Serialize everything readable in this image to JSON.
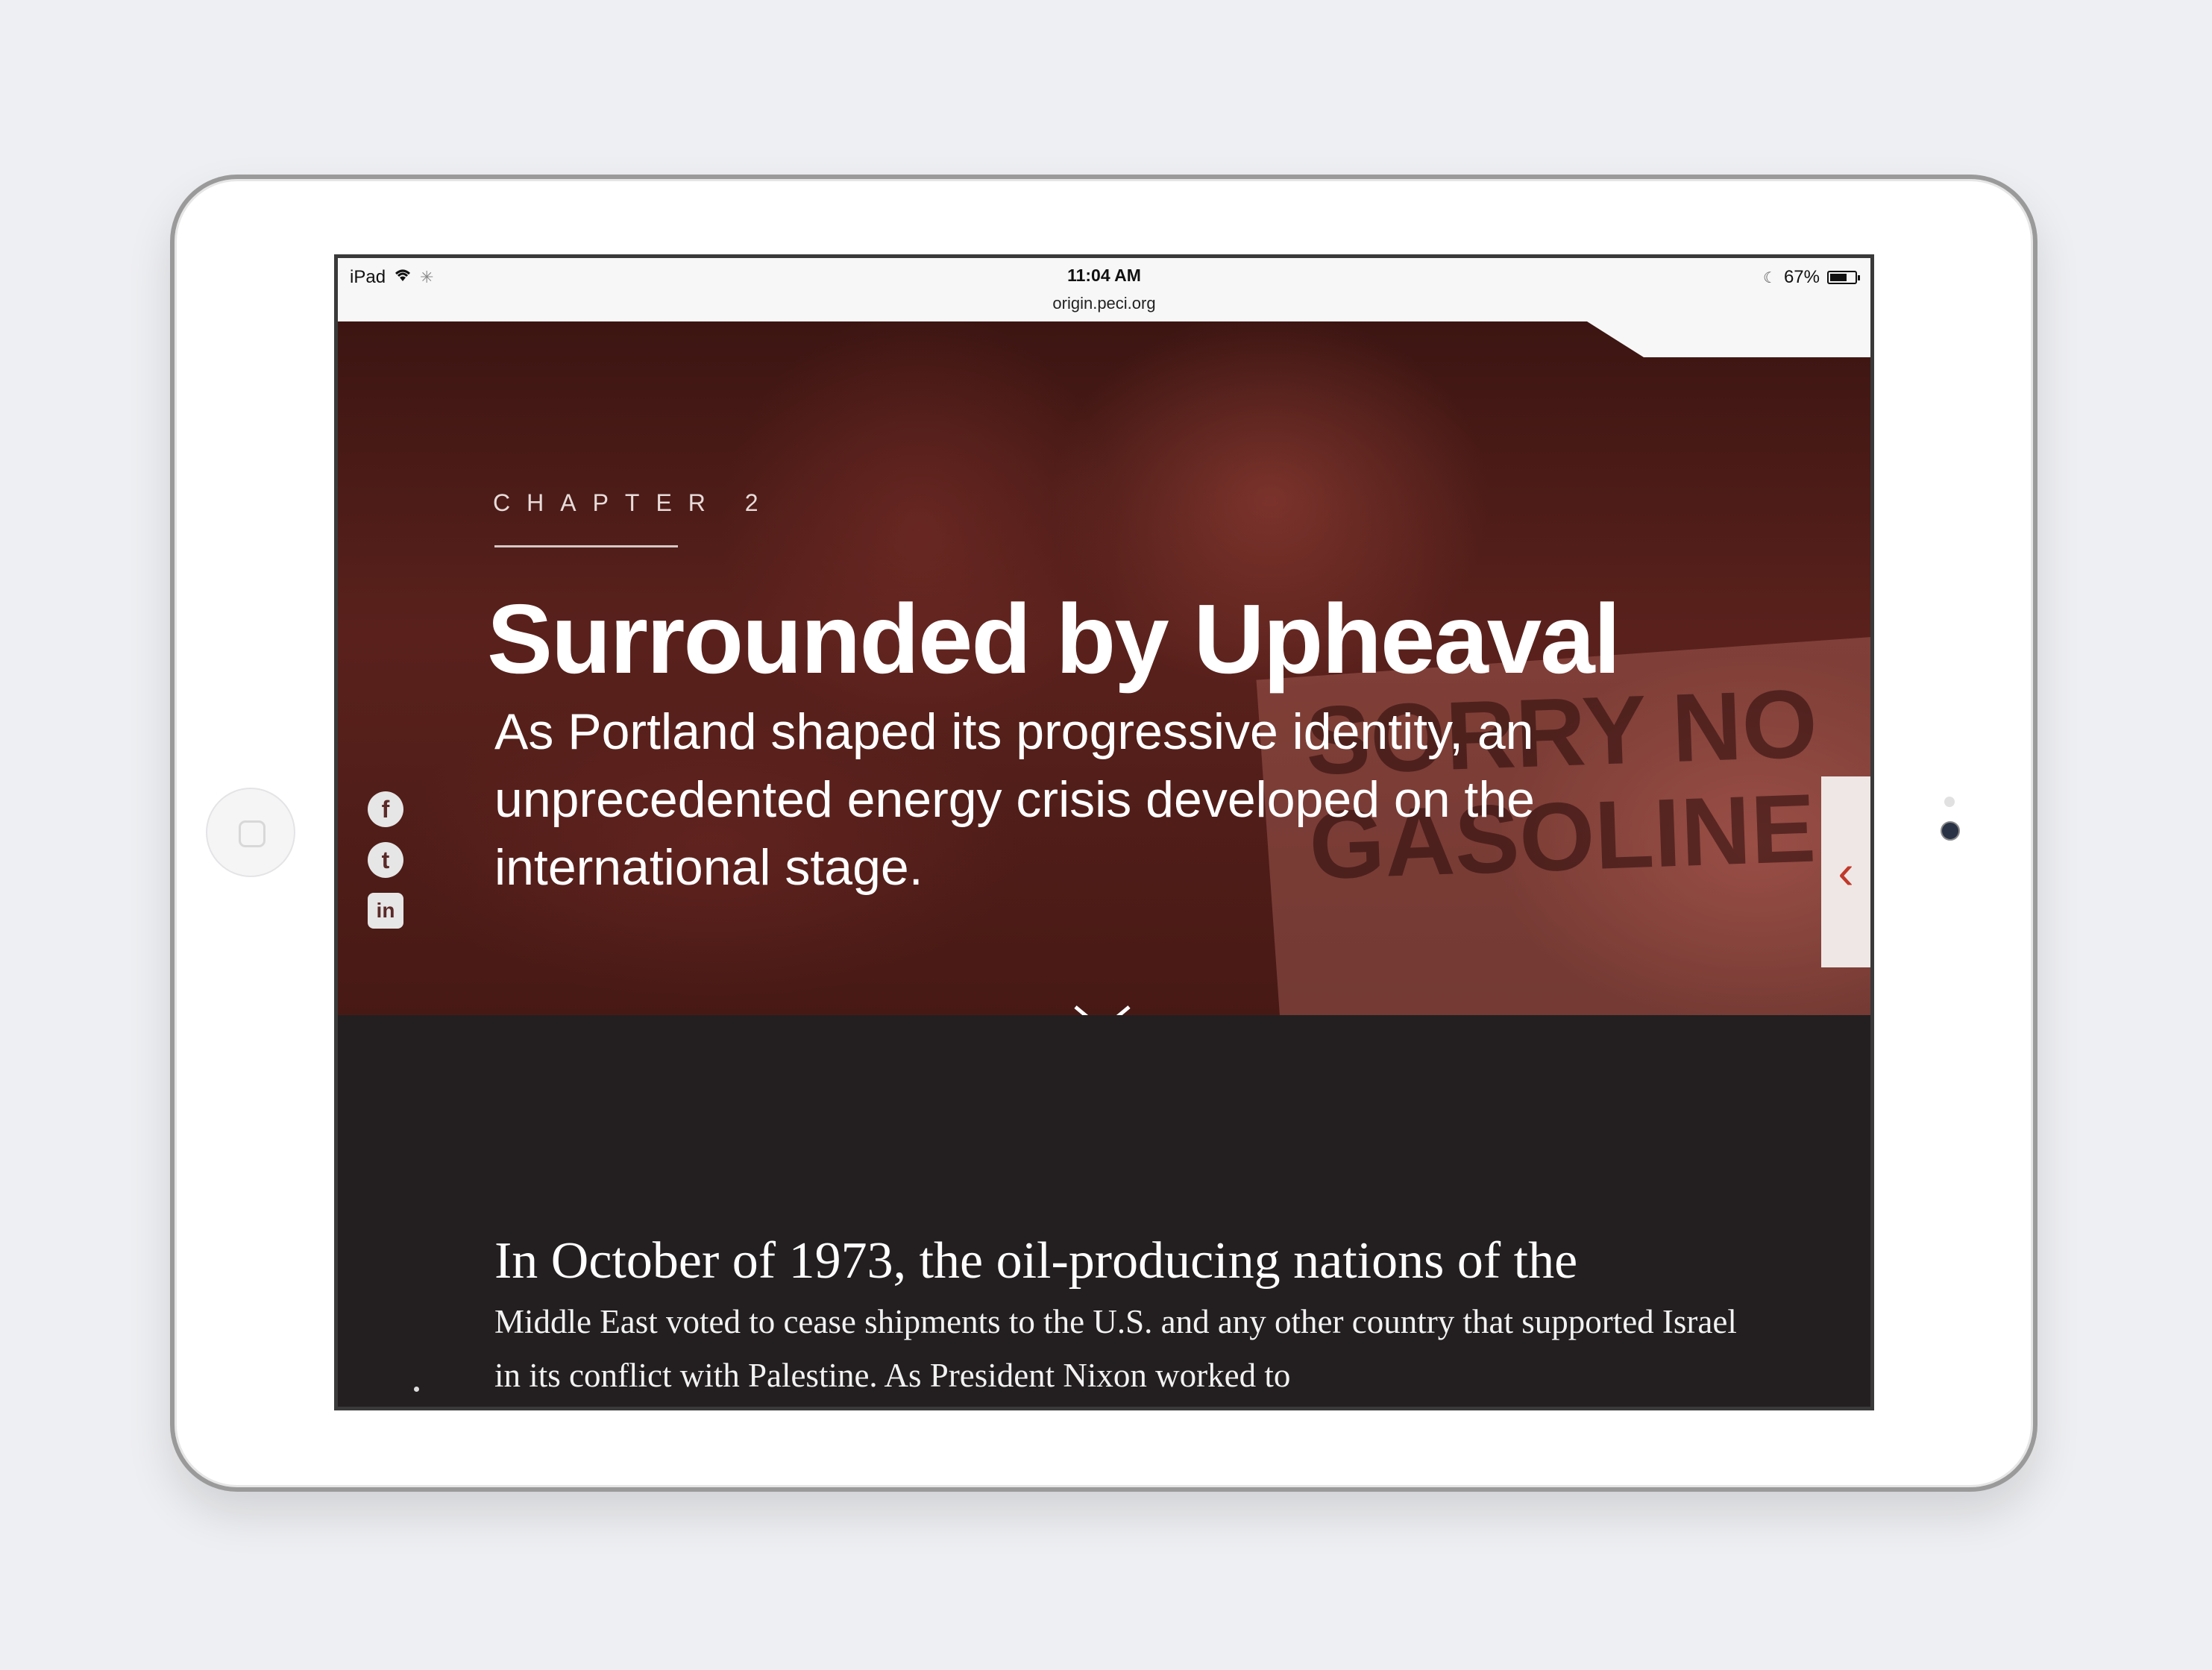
{
  "status_bar": {
    "device": "iPad",
    "time": "11:04 AM",
    "url": "origin.peci.org",
    "battery": "67%"
  },
  "hero": {
    "chapter": "CHAPTER 2",
    "title": "Surrounded by Upheaval",
    "subtitle": "As Portland shaped its progressive identity, an unprecedented energy crisis developed on the international stage.",
    "sign_text": "SORRY NO GASOLINE"
  },
  "social": {
    "facebook": "f",
    "twitter": "t",
    "linkedin": "in"
  },
  "nav": {
    "prev_glyph": "‹"
  },
  "article": {
    "lead": "In October of 1973, the oil-producing nations of the",
    "body": "Middle East voted to cease shipments to the U.S. and any other country that supported Israel in its conflict with Palestine. As President Nixon worked to"
  },
  "colors": {
    "hero_tint": "#5a211c",
    "body_bg": "#231f20",
    "accent": "#c0392b"
  }
}
